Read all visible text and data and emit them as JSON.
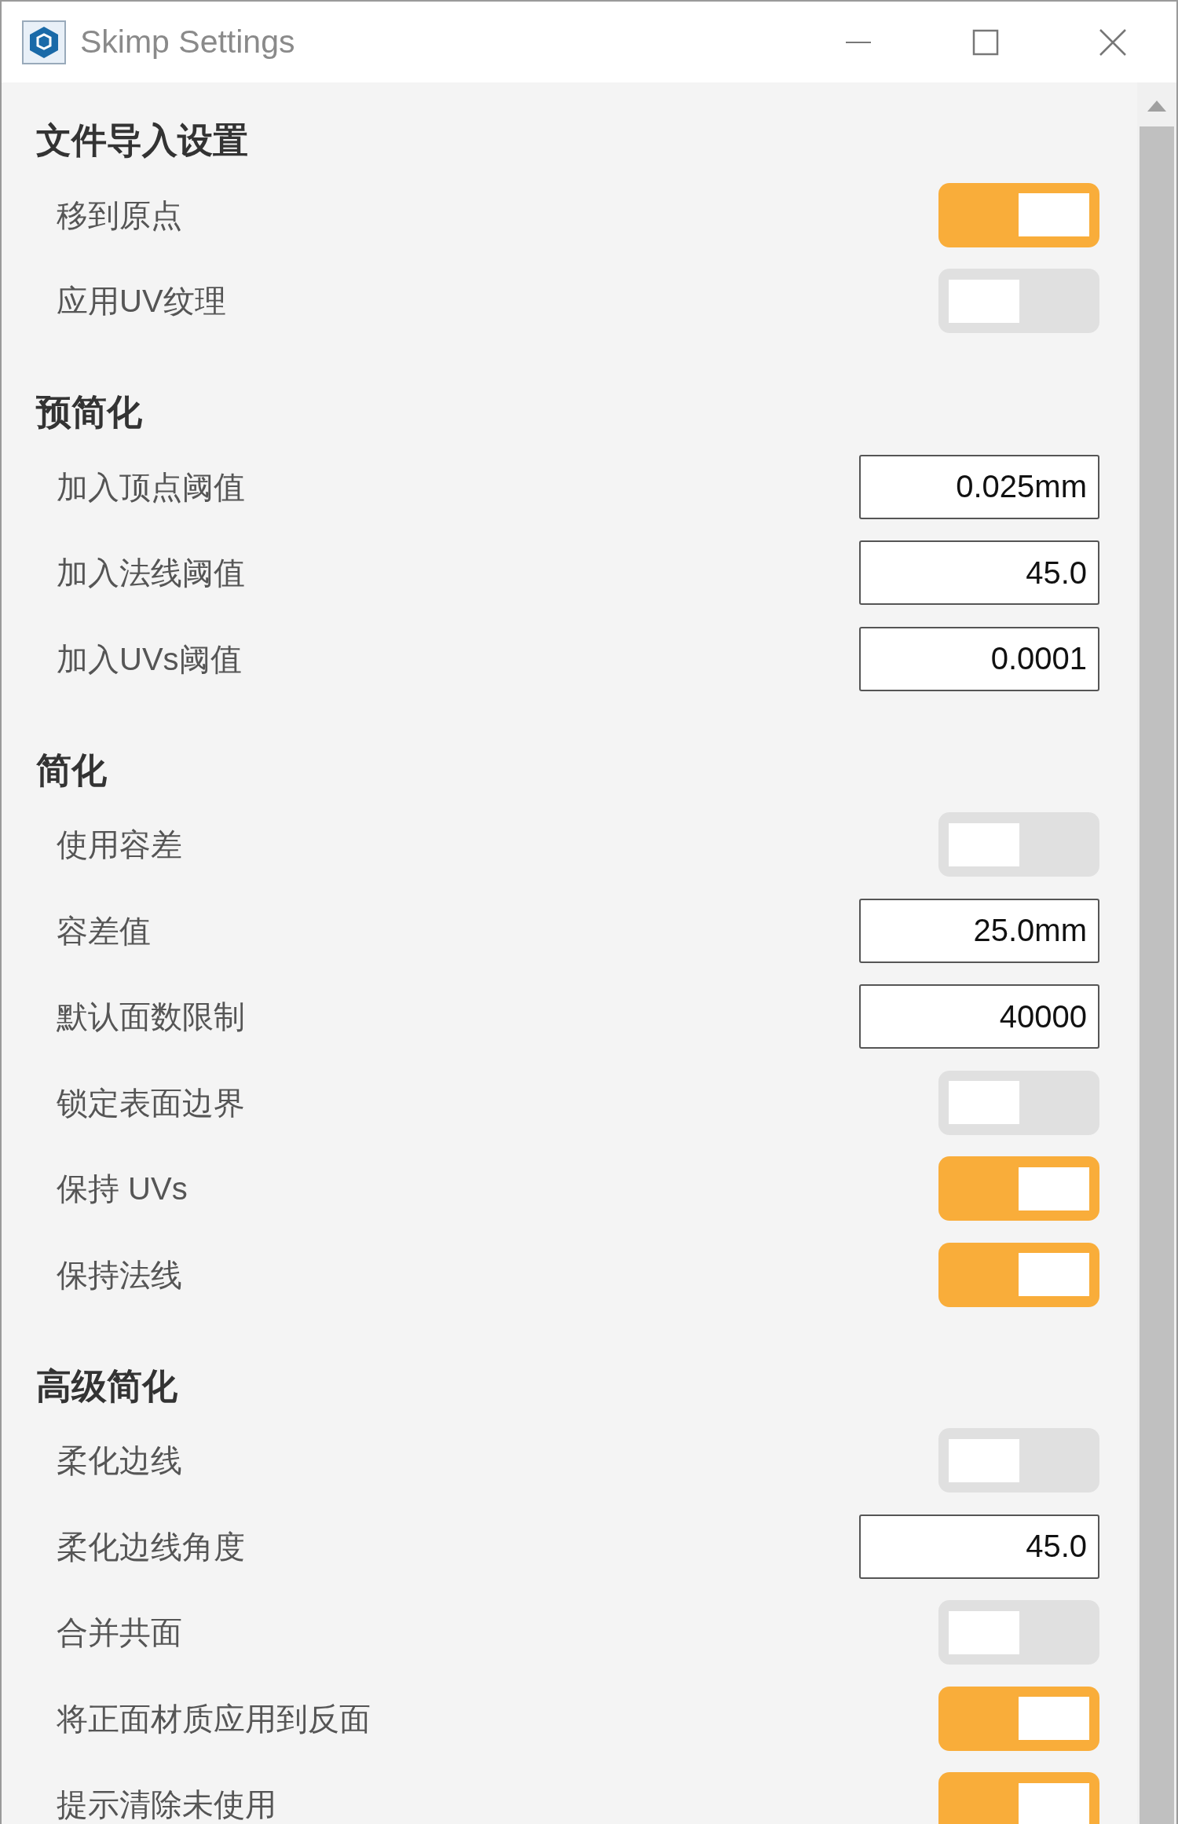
{
  "window": {
    "title": "Skimp Settings"
  },
  "sections": [
    {
      "title": "文件导入设置",
      "settings": [
        {
          "kind": "toggle",
          "label": "移到原点",
          "on": true
        },
        {
          "kind": "toggle",
          "label": "应用UV纹理",
          "on": false
        }
      ]
    },
    {
      "title": "预简化",
      "settings": [
        {
          "kind": "field",
          "label": "加入顶点阈值",
          "value": "0.025mm"
        },
        {
          "kind": "field",
          "label": "加入法线阈值",
          "value": "45.0"
        },
        {
          "kind": "field",
          "label": "加入UVs阈值",
          "value": "0.0001"
        }
      ]
    },
    {
      "title": "简化",
      "settings": [
        {
          "kind": "toggle",
          "label": "使用容差",
          "on": false
        },
        {
          "kind": "field",
          "label": "容差值",
          "value": "25.0mm"
        },
        {
          "kind": "field",
          "label": "默认面数限制",
          "value": "40000"
        },
        {
          "kind": "toggle",
          "label": "锁定表面边界",
          "on": false
        },
        {
          "kind": "toggle",
          "label": "保持 UVs",
          "on": true
        },
        {
          "kind": "toggle",
          "label": "保持法线",
          "on": true
        }
      ]
    },
    {
      "title": "高级简化",
      "settings": [
        {
          "kind": "toggle",
          "label": "柔化边线",
          "on": false
        },
        {
          "kind": "field",
          "label": "柔化边线角度",
          "value": "45.0"
        },
        {
          "kind": "toggle",
          "label": "合并共面",
          "on": false
        },
        {
          "kind": "toggle",
          "label": "将正面材质应用到反面",
          "on": true
        },
        {
          "kind": "toggle",
          "label": "提示清除未使用",
          "on": true
        }
      ]
    }
  ]
}
